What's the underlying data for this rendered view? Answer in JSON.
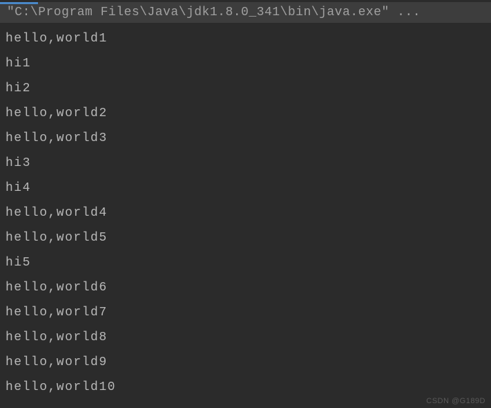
{
  "command": "\"C:\\Program Files\\Java\\jdk1.8.0_341\\bin\\java.exe\" ...",
  "output_lines": [
    "hello,world1",
    "hi1",
    "hi2",
    "hello,world2",
    "hello,world3",
    "hi3",
    "hi4",
    "hello,world4",
    "hello,world5",
    "hi5",
    "hello,world6",
    "hello,world7",
    "hello,world8",
    "hello,world9",
    "hello,world10"
  ],
  "watermark": "CSDN @G189D"
}
